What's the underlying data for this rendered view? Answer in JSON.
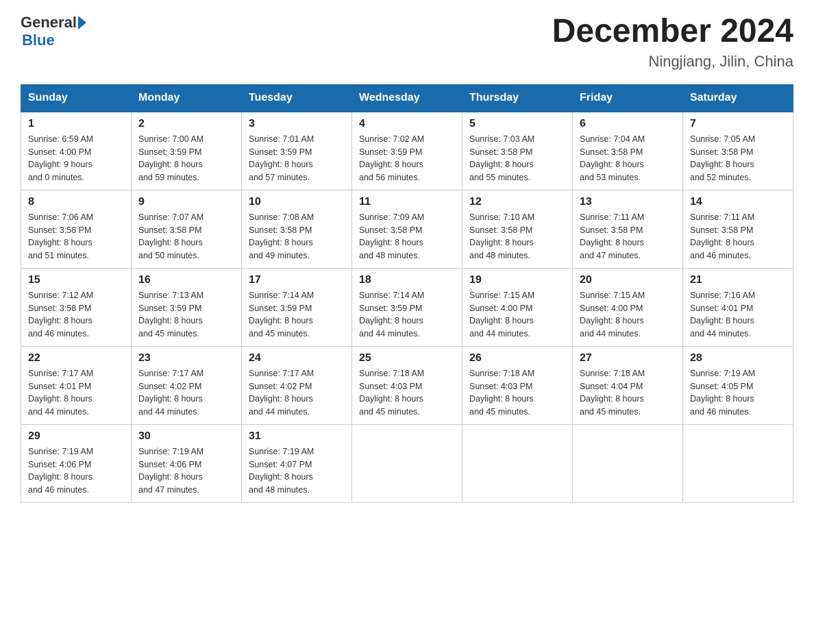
{
  "header": {
    "logo_general": "General",
    "logo_blue": "Blue",
    "month_year": "December 2024",
    "location": "Ningjiang, Jilin, China"
  },
  "columns": [
    "Sunday",
    "Monday",
    "Tuesday",
    "Wednesday",
    "Thursday",
    "Friday",
    "Saturday"
  ],
  "weeks": [
    [
      {
        "day": "1",
        "sunrise": "Sunrise: 6:59 AM",
        "sunset": "Sunset: 4:00 PM",
        "daylight": "Daylight: 9 hours",
        "daylight2": "and 0 minutes."
      },
      {
        "day": "2",
        "sunrise": "Sunrise: 7:00 AM",
        "sunset": "Sunset: 3:59 PM",
        "daylight": "Daylight: 8 hours",
        "daylight2": "and 59 minutes."
      },
      {
        "day": "3",
        "sunrise": "Sunrise: 7:01 AM",
        "sunset": "Sunset: 3:59 PM",
        "daylight": "Daylight: 8 hours",
        "daylight2": "and 57 minutes."
      },
      {
        "day": "4",
        "sunrise": "Sunrise: 7:02 AM",
        "sunset": "Sunset: 3:59 PM",
        "daylight": "Daylight: 8 hours",
        "daylight2": "and 56 minutes."
      },
      {
        "day": "5",
        "sunrise": "Sunrise: 7:03 AM",
        "sunset": "Sunset: 3:58 PM",
        "daylight": "Daylight: 8 hours",
        "daylight2": "and 55 minutes."
      },
      {
        "day": "6",
        "sunrise": "Sunrise: 7:04 AM",
        "sunset": "Sunset: 3:58 PM",
        "daylight": "Daylight: 8 hours",
        "daylight2": "and 53 minutes."
      },
      {
        "day": "7",
        "sunrise": "Sunrise: 7:05 AM",
        "sunset": "Sunset: 3:58 PM",
        "daylight": "Daylight: 8 hours",
        "daylight2": "and 52 minutes."
      }
    ],
    [
      {
        "day": "8",
        "sunrise": "Sunrise: 7:06 AM",
        "sunset": "Sunset: 3:58 PM",
        "daylight": "Daylight: 8 hours",
        "daylight2": "and 51 minutes."
      },
      {
        "day": "9",
        "sunrise": "Sunrise: 7:07 AM",
        "sunset": "Sunset: 3:58 PM",
        "daylight": "Daylight: 8 hours",
        "daylight2": "and 50 minutes."
      },
      {
        "day": "10",
        "sunrise": "Sunrise: 7:08 AM",
        "sunset": "Sunset: 3:58 PM",
        "daylight": "Daylight: 8 hours",
        "daylight2": "and 49 minutes."
      },
      {
        "day": "11",
        "sunrise": "Sunrise: 7:09 AM",
        "sunset": "Sunset: 3:58 PM",
        "daylight": "Daylight: 8 hours",
        "daylight2": "and 48 minutes."
      },
      {
        "day": "12",
        "sunrise": "Sunrise: 7:10 AM",
        "sunset": "Sunset: 3:58 PM",
        "daylight": "Daylight: 8 hours",
        "daylight2": "and 48 minutes."
      },
      {
        "day": "13",
        "sunrise": "Sunrise: 7:11 AM",
        "sunset": "Sunset: 3:58 PM",
        "daylight": "Daylight: 8 hours",
        "daylight2": "and 47 minutes."
      },
      {
        "day": "14",
        "sunrise": "Sunrise: 7:11 AM",
        "sunset": "Sunset: 3:58 PM",
        "daylight": "Daylight: 8 hours",
        "daylight2": "and 46 minutes."
      }
    ],
    [
      {
        "day": "15",
        "sunrise": "Sunrise: 7:12 AM",
        "sunset": "Sunset: 3:58 PM",
        "daylight": "Daylight: 8 hours",
        "daylight2": "and 46 minutes."
      },
      {
        "day": "16",
        "sunrise": "Sunrise: 7:13 AM",
        "sunset": "Sunset: 3:59 PM",
        "daylight": "Daylight: 8 hours",
        "daylight2": "and 45 minutes."
      },
      {
        "day": "17",
        "sunrise": "Sunrise: 7:14 AM",
        "sunset": "Sunset: 3:59 PM",
        "daylight": "Daylight: 8 hours",
        "daylight2": "and 45 minutes."
      },
      {
        "day": "18",
        "sunrise": "Sunrise: 7:14 AM",
        "sunset": "Sunset: 3:59 PM",
        "daylight": "Daylight: 8 hours",
        "daylight2": "and 44 minutes."
      },
      {
        "day": "19",
        "sunrise": "Sunrise: 7:15 AM",
        "sunset": "Sunset: 4:00 PM",
        "daylight": "Daylight: 8 hours",
        "daylight2": "and 44 minutes."
      },
      {
        "day": "20",
        "sunrise": "Sunrise: 7:15 AM",
        "sunset": "Sunset: 4:00 PM",
        "daylight": "Daylight: 8 hours",
        "daylight2": "and 44 minutes."
      },
      {
        "day": "21",
        "sunrise": "Sunrise: 7:16 AM",
        "sunset": "Sunset: 4:01 PM",
        "daylight": "Daylight: 8 hours",
        "daylight2": "and 44 minutes."
      }
    ],
    [
      {
        "day": "22",
        "sunrise": "Sunrise: 7:17 AM",
        "sunset": "Sunset: 4:01 PM",
        "daylight": "Daylight: 8 hours",
        "daylight2": "and 44 minutes."
      },
      {
        "day": "23",
        "sunrise": "Sunrise: 7:17 AM",
        "sunset": "Sunset: 4:02 PM",
        "daylight": "Daylight: 8 hours",
        "daylight2": "and 44 minutes."
      },
      {
        "day": "24",
        "sunrise": "Sunrise: 7:17 AM",
        "sunset": "Sunset: 4:02 PM",
        "daylight": "Daylight: 8 hours",
        "daylight2": "and 44 minutes."
      },
      {
        "day": "25",
        "sunrise": "Sunrise: 7:18 AM",
        "sunset": "Sunset: 4:03 PM",
        "daylight": "Daylight: 8 hours",
        "daylight2": "and 45 minutes."
      },
      {
        "day": "26",
        "sunrise": "Sunrise: 7:18 AM",
        "sunset": "Sunset: 4:03 PM",
        "daylight": "Daylight: 8 hours",
        "daylight2": "and 45 minutes."
      },
      {
        "day": "27",
        "sunrise": "Sunrise: 7:18 AM",
        "sunset": "Sunset: 4:04 PM",
        "daylight": "Daylight: 8 hours",
        "daylight2": "and 45 minutes."
      },
      {
        "day": "28",
        "sunrise": "Sunrise: 7:19 AM",
        "sunset": "Sunset: 4:05 PM",
        "daylight": "Daylight: 8 hours",
        "daylight2": "and 46 minutes."
      }
    ],
    [
      {
        "day": "29",
        "sunrise": "Sunrise: 7:19 AM",
        "sunset": "Sunset: 4:06 PM",
        "daylight": "Daylight: 8 hours",
        "daylight2": "and 46 minutes."
      },
      {
        "day": "30",
        "sunrise": "Sunrise: 7:19 AM",
        "sunset": "Sunset: 4:06 PM",
        "daylight": "Daylight: 8 hours",
        "daylight2": "and 47 minutes."
      },
      {
        "day": "31",
        "sunrise": "Sunrise: 7:19 AM",
        "sunset": "Sunset: 4:07 PM",
        "daylight": "Daylight: 8 hours",
        "daylight2": "and 48 minutes."
      },
      null,
      null,
      null,
      null
    ]
  ]
}
